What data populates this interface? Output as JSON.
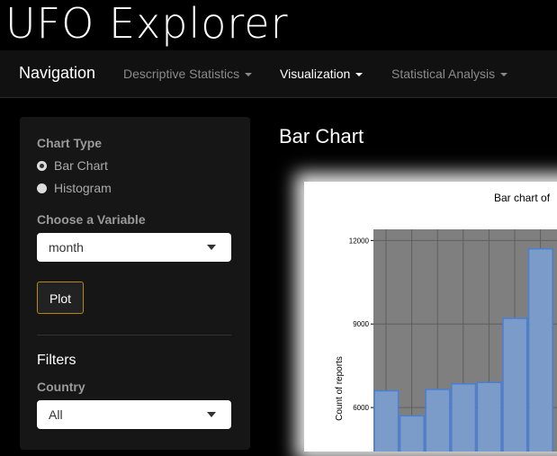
{
  "app": {
    "title": "UFO Explorer"
  },
  "navbar": {
    "brand": "Navigation",
    "items": [
      {
        "label": "Descriptive Statistics",
        "active": false
      },
      {
        "label": "Visualization",
        "active": true
      },
      {
        "label": "Statistical Analysis",
        "active": false
      }
    ]
  },
  "sidebar": {
    "chart_type_label": "Chart Type",
    "chart_types": [
      {
        "label": "Bar Chart",
        "checked": true
      },
      {
        "label": "Histogram",
        "checked": false
      }
    ],
    "variable_label": "Choose a Variable",
    "variable_value": "month",
    "plot_button": "Plot",
    "filters_title": "Filters",
    "country_label": "Country",
    "country_value": "All"
  },
  "main": {
    "title": "Bar Chart"
  },
  "chart_data": {
    "type": "bar",
    "title": "Bar chart of",
    "xlabel": "",
    "ylabel": "Count of reports",
    "y_ticks": [
      6000,
      9000,
      12000
    ],
    "ylim": [
      4000,
      12400
    ],
    "grid": true,
    "colors": {
      "panel": "#7f7f7f",
      "bar_fill": "#7b9cc8",
      "bar_stroke": "#4a7fd4"
    },
    "values": [
      6600,
      5700,
      6650,
      6850,
      6900,
      9200,
      11700
    ]
  }
}
